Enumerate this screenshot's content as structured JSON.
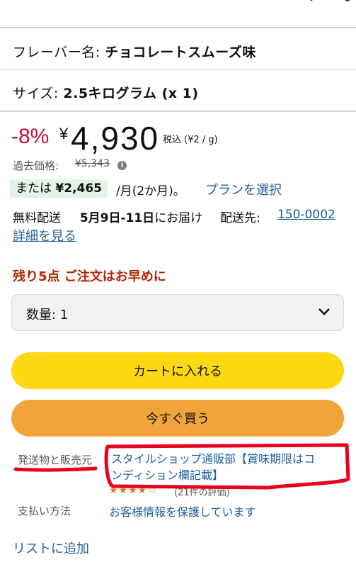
{
  "flavor": {
    "label": "フレーバー名:",
    "value": "チョコレートスムーズ味"
  },
  "size": {
    "label": "サイズ:",
    "value": "2.5キログラム (x 1)"
  },
  "pricing": {
    "discount": "-8%",
    "currency": "¥",
    "price": "4,930",
    "tax_note": "税込 (¥2 / g)",
    "past_label": "過去価格:",
    "past_price": "¥5,343",
    "info_icon": "i"
  },
  "subscription": {
    "prefix": "または",
    "price": "¥2,465",
    "period": "/月(2か月)。",
    "plan_link": "プランを選択"
  },
  "delivery": {
    "prefix": "無料配送",
    "dates": "5月9日-11日",
    "suffix": "にお届け",
    "ship_to_label": "配送先:",
    "postal": "150-0002",
    "details_link": "詳細を見る"
  },
  "stock": "残り5点 ご注文はお早めに",
  "quantity": {
    "label": "数量: 1"
  },
  "buttons": {
    "cart": "カートに入れる",
    "buy_now": "今すぐ買う"
  },
  "seller": {
    "label": "発送物と販売元",
    "name": "スタイルショップ通販部【賞味期限はコンディション欄記載】",
    "stars": "★★★★☆",
    "review_count": "(21件の評価)"
  },
  "payment": {
    "label": "支払い方法",
    "value": "お客様情報を保護しています"
  },
  "add_to_list": "リストに追加",
  "colors": {
    "accent_link": "#1f5f99",
    "discount_red": "#cc0c39",
    "cart_yellow": "#ffd814",
    "buy_orange": "#f0a43a",
    "annotation_red": "#e8001c"
  },
  "icons": [
    "chevron-down-icon",
    "share-icon",
    "info-icon"
  ]
}
